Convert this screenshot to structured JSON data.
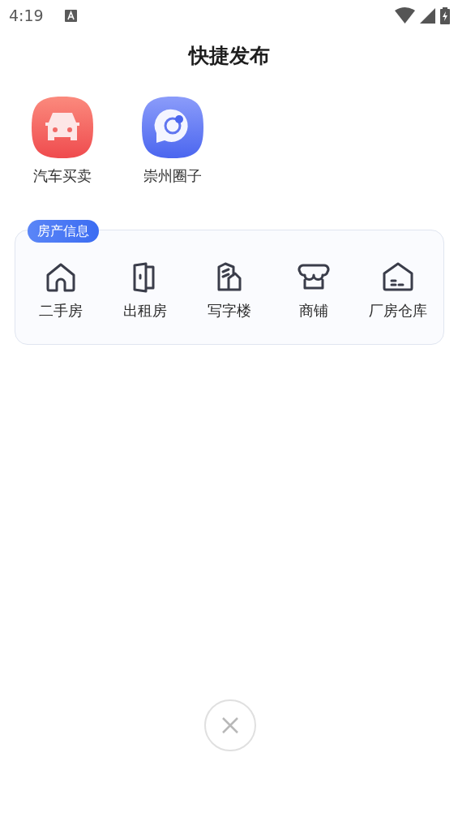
{
  "status_bar": {
    "time": "4:19"
  },
  "title": "快捷发布",
  "quick_items": [
    {
      "label": "汽车买卖",
      "kind": "car"
    },
    {
      "label": "崇州圈子",
      "kind": "chat"
    }
  ],
  "property_section": {
    "badge": "房产信息",
    "items": [
      {
        "label": "二手房",
        "kind": "house"
      },
      {
        "label": "出租房",
        "kind": "door"
      },
      {
        "label": "写字楼",
        "kind": "building"
      },
      {
        "label": "商铺",
        "kind": "shop"
      },
      {
        "label": "厂房仓库",
        "kind": "warehouse"
      }
    ]
  }
}
